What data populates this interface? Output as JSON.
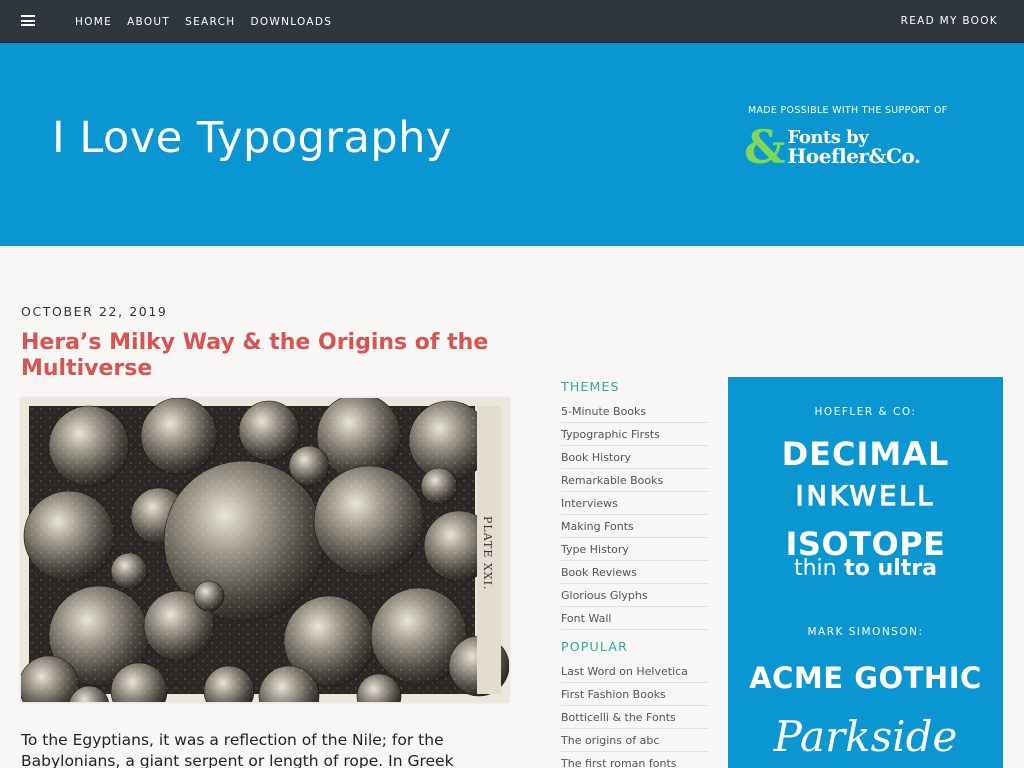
{
  "nav": {
    "links": [
      "HOME",
      "ABOUT",
      "SEARCH",
      "DOWNLOADS"
    ],
    "right": "READ MY BOOK"
  },
  "banner": {
    "site_title": "I Love Typography",
    "support_label": "MADE POSSIBLE WITH THE SUPPORT OF",
    "sponsor_amp": "&",
    "sponsor_line1": "Fonts by",
    "sponsor_line2": "Hoefler&Co."
  },
  "post": {
    "date": "OCTOBER 22, 2019",
    "title": "Hera’s Milky Way & the Origins of the Multiverse",
    "plate_label": "PLATE XXI.",
    "text": "To the Egyptians, it was a reflection of the Nile; for the Babylonians, a giant serpent or length of rope. In Greek mythology, the infant"
  },
  "sidebar": {
    "themes_heading": "THEMES",
    "themes": [
      "5-Minute Books",
      "Typographic Firsts",
      "Book History",
      "Remarkable Books",
      "Interviews",
      "Making Fonts",
      "Type History",
      "Book Reviews",
      "Glorious Glyphs",
      "Font Wall"
    ],
    "popular_heading": "POPULAR",
    "popular": [
      "Last Word on Helvetica",
      "First Fashion Books",
      "Botticelli & the Fonts",
      "The origins of abc",
      "The first roman fonts"
    ]
  },
  "ad": {
    "label1": "HOEFLER & CO:",
    "font1": "DECIMAL",
    "font2": "INKWELL",
    "font3": "ISOTOPE",
    "font3_thin": "thin",
    "font3_to": "to",
    "font3_ultra": "ultra",
    "label2": "MARK SIMONSON:",
    "font4": "ACME GOTHIC",
    "font5": "Parkside"
  },
  "colors": {
    "nav_bg": "#2f3640",
    "banner_bg": "#0a97d1",
    "title_red": "#d9534f",
    "sidebar_teal": "#2aab9e",
    "sponsor_green": "#7ed957"
  }
}
